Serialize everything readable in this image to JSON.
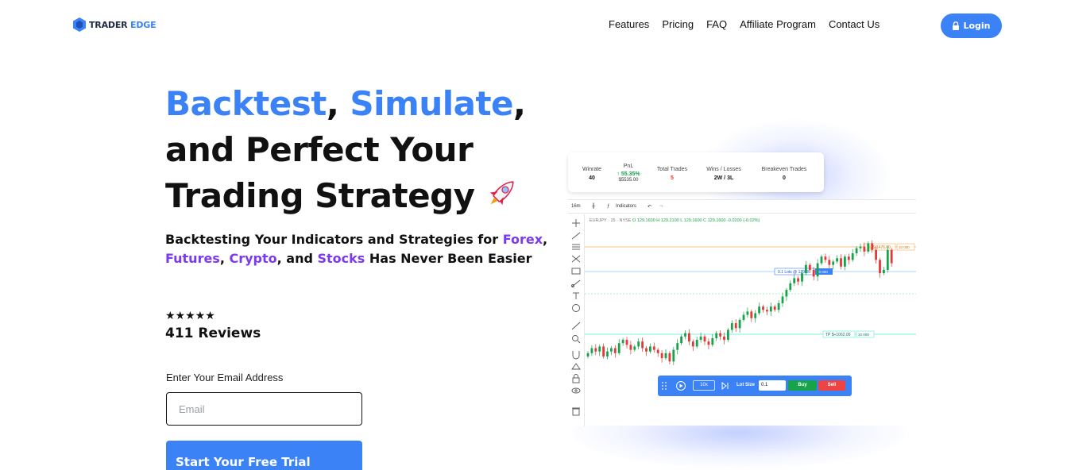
{
  "brand": {
    "name_part1": "TRADER",
    "name_part2": "EDGE"
  },
  "nav": {
    "links": [
      "Features",
      "Pricing",
      "FAQ",
      "Affiliate Program",
      "Contact Us"
    ],
    "login_label": "Login"
  },
  "hero": {
    "word1": "Backtest",
    "sep1": ", ",
    "word2": "Simulate",
    "sep2": ",",
    "line2": "and Perfect Your",
    "line3": "Trading Strategy",
    "subtitle": {
      "prefix": "Backtesting Your Indicators and Strategies for ",
      "market1": "Forex",
      "comma1": ", ",
      "market2": "Futures",
      "comma2": ", ",
      "market3": "Crypto",
      "and": ", and ",
      "market4": "Stocks",
      "suffix": " Has Never Been Easier"
    },
    "rating_stars": "★★★★★",
    "reviews": "411 Reviews",
    "email_label": "Enter Your Email Address",
    "email_placeholder": "Email",
    "cta_label": "Start Your Free Trial Today →"
  },
  "stats": {
    "winrate_label": "Winrate",
    "winrate_value": "40",
    "pnl_label": "PnL",
    "pnl_value": "↑ 55.35%",
    "pnl_amount": "$5535.00",
    "total_label": "Total Trades",
    "total_value": "5",
    "wl_label": "Wins / Losses",
    "wl_value": "2W / 3L",
    "be_label": "Breakeven Trades",
    "be_value": "0"
  },
  "chart_toolbar": {
    "timeframe": "16m",
    "indicators": "Indicators"
  },
  "chart_symbol": {
    "name": "EURJPY · 15 · NYSE",
    "values": "O 129.1600  H 129.2100  L 129.1600  C 129.1600  -0.0200 (-0.02%)"
  },
  "chart_levels": {
    "sl": "SL $-1476.00",
    "sl_right": "10 000",
    "entry": "0.1 Lots @ 129.00",
    "entry_right": "10 000",
    "tp": "TP $+1062.00",
    "tp_right": "10 000"
  },
  "replay": {
    "speed": "10x",
    "lot_label": "Lot Size",
    "lot_value": "0.1",
    "buy": "Buy",
    "sell": "Sell"
  },
  "colors": {
    "accent": "#3b82f6",
    "purple": "#7c3aed",
    "up": "#16a34a",
    "down": "#e53935"
  },
  "chart_data": {
    "type": "candlestick",
    "title": "",
    "xlabel": "",
    "ylabel": "",
    "closes": [
      129.02,
      129.05,
      129.03,
      129.06,
      129.0,
      129.03,
      129.05,
      129.02,
      129.08,
      129.1,
      129.07,
      129.04,
      129.06,
      129.09,
      129.05,
      129.03,
      129.06,
      129.04,
      129.02,
      128.99,
      129.02,
      128.97,
      129.04,
      129.08,
      129.12,
      129.14,
      129.09,
      129.06,
      129.1,
      129.12,
      129.09,
      129.07,
      129.11,
      129.14,
      129.12,
      129.1,
      129.16,
      129.2,
      129.17,
      129.22,
      129.25,
      129.27,
      129.23,
      129.26,
      129.3,
      129.28,
      129.27,
      129.3,
      129.28,
      129.32,
      129.36,
      129.4,
      129.44,
      129.47,
      129.45,
      129.5,
      129.55,
      129.52,
      129.48,
      129.56,
      129.6,
      129.58,
      129.55,
      129.57,
      129.59,
      129.54,
      129.6,
      129.58,
      129.62,
      129.65,
      129.66,
      129.63,
      129.68,
      129.64,
      129.58,
      129.5,
      129.52,
      129.64,
      129.56
    ]
  }
}
